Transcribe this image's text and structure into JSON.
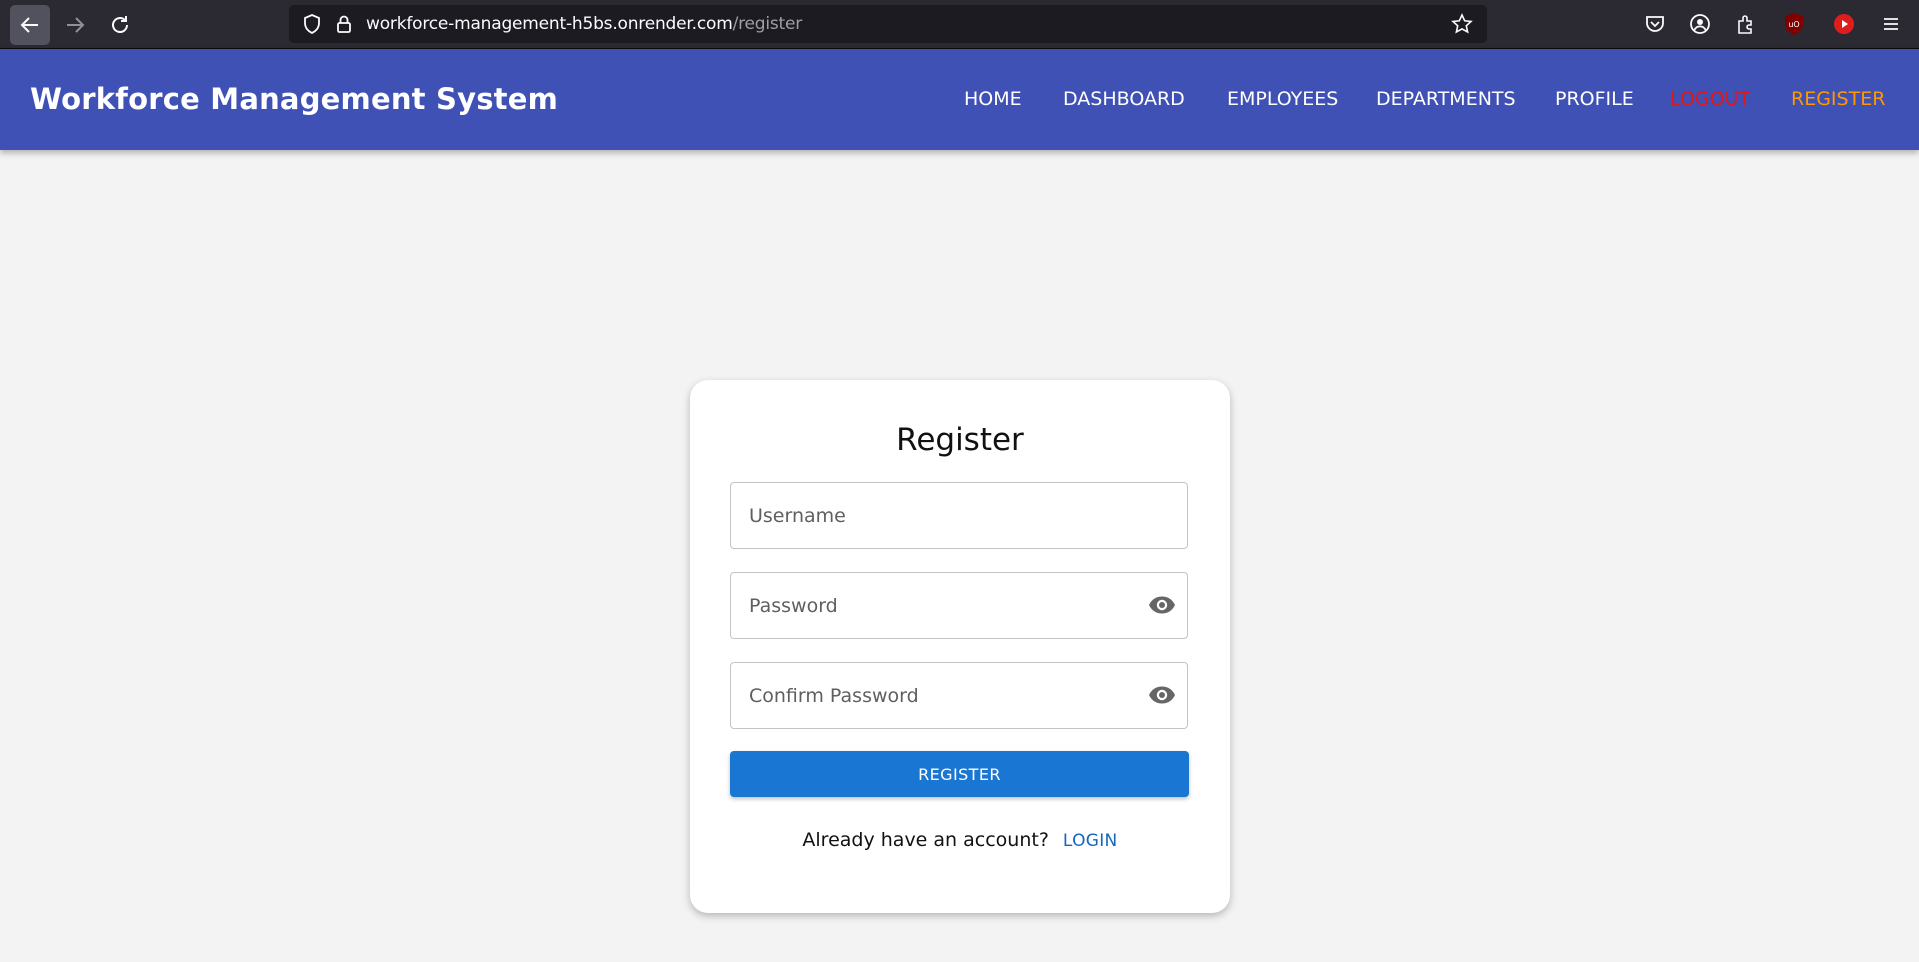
{
  "browser": {
    "url_host": "workforce-management-h5bs.onrender.com",
    "url_path": "/register",
    "icons": [
      "back-arrow-icon",
      "forward-arrow-icon",
      "reload-icon",
      "shield-icon",
      "lock-icon",
      "star-icon",
      "pocket-icon",
      "account-icon",
      "extensions-icon",
      "ublock-icon",
      "youtube-icon",
      "menu-icon"
    ]
  },
  "app": {
    "brand": "Workforce Management System",
    "nav": {
      "home": "HOME",
      "dashboard": "DASHBOARD",
      "employees": "EMPLOYEES",
      "departments": "DEPARTMENTS",
      "profile": "PROFILE",
      "logout": "LOGOUT",
      "register": "REGISTER"
    },
    "colors": {
      "nav_bg": "#3f51b5",
      "logout": "#e0161b",
      "register_link": "#ff9800",
      "button": "#1976d2"
    }
  },
  "form": {
    "title": "Register",
    "username_placeholder": "Username",
    "password_placeholder": "Password",
    "confirm_placeholder": "Confirm Password",
    "submit_label": "REGISTER",
    "login_prompt": "Already have an account?",
    "login_label": "LOGIN"
  }
}
